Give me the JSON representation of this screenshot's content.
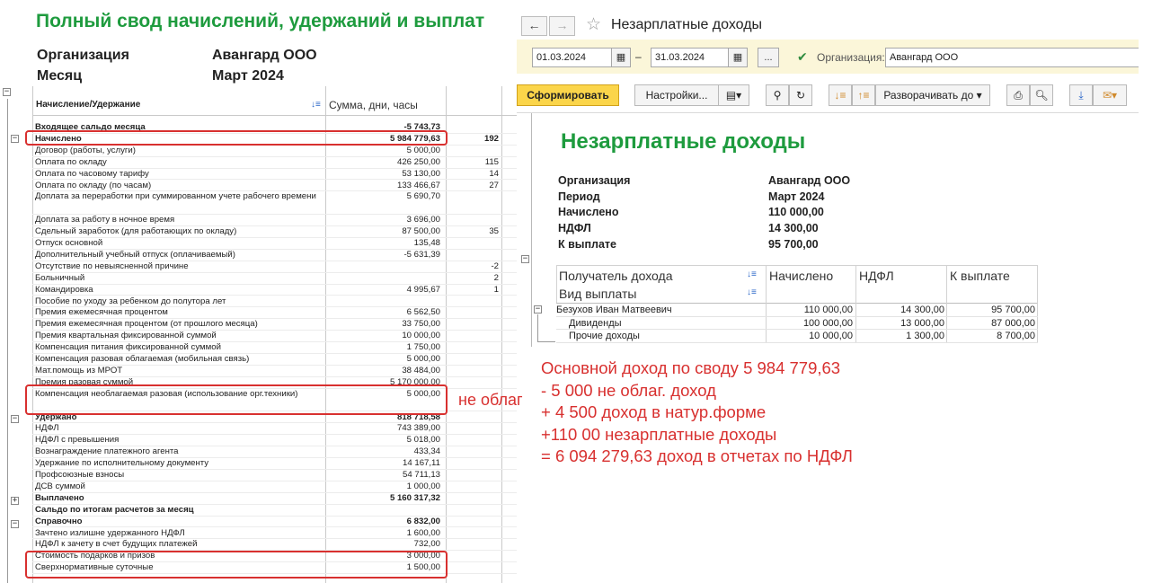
{
  "left_report": {
    "title": "Полный свод начислений, удержаний и выплат",
    "org_label": "Организация",
    "org_value": "Авангард ООО",
    "month_label": "Месяц",
    "month_value": "Март 2024",
    "col_name": "Начисление/Удержание",
    "col_sum": "Сумма, дни, часы",
    "rows": [
      {
        "name": "Входящее сальдо месяца",
        "amount": "-5 743,73",
        "hours": "",
        "bold": true
      },
      {
        "name": "Начислено",
        "amount": "5 984 779,63",
        "hours": "192",
        "bold": true
      },
      {
        "name": "Договор (работы, услуги)",
        "amount": "5 000,00",
        "hours": ""
      },
      {
        "name": "Оплата по окладу",
        "amount": "426 250,00",
        "hours": "115"
      },
      {
        "name": "Оплата по часовому тарифу",
        "amount": "53 130,00",
        "hours": "14"
      },
      {
        "name": "Оплата по окладу (по часам)",
        "amount": "133 466,67",
        "hours": "27"
      },
      {
        "name": "Доплата за переработки при суммированном учете рабочего времени",
        "amount": "5 690,70",
        "hours": "",
        "wrap": true
      },
      {
        "name": "Доплата за работу в ночное время",
        "amount": "3 696,00",
        "hours": ""
      },
      {
        "name": "Сдельный заработок (для работающих по окладу)",
        "amount": "87 500,00",
        "hours": "35"
      },
      {
        "name": "Отпуск основной",
        "amount": "135,48",
        "hours": ""
      },
      {
        "name": "Дополнительный учебный отпуск (оплачиваемый)",
        "amount": "-5 631,39",
        "hours": ""
      },
      {
        "name": "Отсутствие по невыясненной причине",
        "amount": "",
        "hours": "-2"
      },
      {
        "name": "Больничный",
        "amount": "",
        "hours": "2"
      },
      {
        "name": "Командировка",
        "amount": "4 995,67",
        "hours": "1"
      },
      {
        "name": "Пособие по уходу за ребенком до полутора лет",
        "amount": "",
        "hours": ""
      },
      {
        "name": "Премия ежемесячная процентом",
        "amount": "6 562,50",
        "hours": ""
      },
      {
        "name": "Премия ежемесячная процентом (от прошлого месяца)",
        "amount": "33 750,00",
        "hours": ""
      },
      {
        "name": "Премия квартальная фиксированной суммой",
        "amount": "10 000,00",
        "hours": ""
      },
      {
        "name": "Компенсация питания фиксированной суммой",
        "amount": "1 750,00",
        "hours": ""
      },
      {
        "name": "Компенсация разовая облагаемая (мобильная связь)",
        "amount": "5 000,00",
        "hours": ""
      },
      {
        "name": "Мат.помощь из МРОТ",
        "amount": "38 484,00",
        "hours": ""
      },
      {
        "name": "Премия разовая суммой",
        "amount": "5 170 000,00",
        "hours": ""
      },
      {
        "name": "Компенсация необлагаемая разовая (использование орг.техники)",
        "amount": "5 000,00",
        "hours": "",
        "wrap": true
      },
      {
        "name": "Удержано",
        "amount": "818 718,58",
        "hours": "",
        "bold": true
      },
      {
        "name": "НДФЛ",
        "amount": "743 389,00",
        "hours": ""
      },
      {
        "name": "НДФЛ с превышения",
        "amount": "5 018,00",
        "hours": ""
      },
      {
        "name": "Вознаграждение платежного агента",
        "amount": "433,34",
        "hours": ""
      },
      {
        "name": "Удержание по исполнительному документу",
        "amount": "14 167,11",
        "hours": ""
      },
      {
        "name": "Профсоюзные взносы",
        "amount": "54 711,13",
        "hours": ""
      },
      {
        "name": "ДСВ суммой",
        "amount": "1 000,00",
        "hours": ""
      },
      {
        "name": "Выплачено",
        "amount": "5 160 317,32",
        "hours": "",
        "bold": true
      },
      {
        "name": "Сальдо по итогам расчетов за месяц",
        "amount": "",
        "hours": "",
        "bold": true
      },
      {
        "name": "Справочно",
        "amount": "6 832,00",
        "hours": "",
        "bold": true
      },
      {
        "name": "Зачтено излишне удержанного НДФЛ",
        "amount": "1 600,00",
        "hours": ""
      },
      {
        "name": "НДФЛ к зачету в счет будущих платежей",
        "amount": "732,00",
        "hours": ""
      },
      {
        "name": "Стоимость подарков и призов",
        "amount": "3 000,00",
        "hours": ""
      },
      {
        "name": "Сверхнормативные суточные",
        "amount": "1 500,00",
        "hours": ""
      }
    ]
  },
  "right_window": {
    "title": "Незарплатные доходы",
    "date_from": "01.03.2024",
    "date_to": "31.03.2024",
    "dash": "–",
    "ellipsis": "...",
    "org_label": "Организация:",
    "org_value": "Авангард ООО",
    "btn_generate": "Сформировать",
    "btn_settings": "Настройки...",
    "btn_expand": "Разворачивать до",
    "report": {
      "title": "Незарплатные доходы",
      "fields": [
        {
          "label": "Организация",
          "value": "Авангард ООО"
        },
        {
          "label": "Период",
          "value": "Март 2024"
        },
        {
          "label": "Начислено",
          "value": "110 000,00"
        },
        {
          "label": "НДФЛ",
          "value": "14 300,00"
        },
        {
          "label": "К выплате",
          "value": "95 700,00"
        }
      ],
      "col_recipient": "Получатель дохода",
      "col_paytype": "Вид выплаты",
      "col_accrued": "Начислено",
      "col_ndfl": "НДФЛ",
      "col_payout": "К выплате",
      "rows": [
        {
          "name": "Безухов Иван Матвеевич",
          "accrued": "110 000,00",
          "ndfl": "14 300,00",
          "payout": "95 700,00"
        },
        {
          "name": "Дивиденды",
          "accrued": "100 000,00",
          "ndfl": "13 000,00",
          "payout": "87 000,00"
        },
        {
          "name": "Прочие доходы",
          "accrued": "10 000,00",
          "ndfl": "1 300,00",
          "payout": "8 700,00"
        }
      ]
    }
  },
  "annotation": {
    "overflow_text": "не облаг",
    "lines": [
      "Основной доход по своду 5 984 779,63",
      "- 5 000 не облаг. доход",
      "+ 4 500 доход в натур.форме",
      "+110 00 незарплатные доходы",
      "= 6 094 279,63 доход в отчетах по НДФЛ"
    ]
  },
  "colors": {
    "title_green": "#1e9b3e",
    "annotation_red": "#d8302f",
    "generate_yellow": "#fbd54a",
    "filter_bg": "#fbf6d9"
  }
}
